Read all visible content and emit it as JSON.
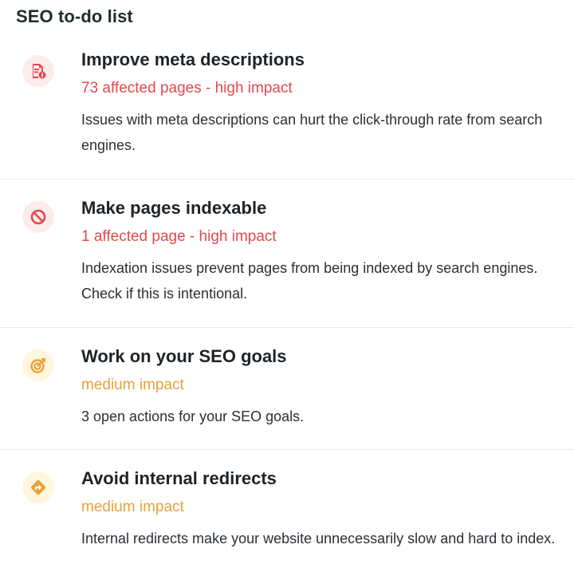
{
  "title": "SEO to-do list",
  "colors": {
    "high_impact": "#e5484d",
    "medium_impact": "#e8a13a",
    "red_badge_bg": "#fdecec",
    "yellow_badge_bg": "#fff6de"
  },
  "items": [
    {
      "icon": "document-info-icon",
      "title": "Improve meta descriptions",
      "impact": "73 affected pages - high impact",
      "description": "Issues with meta descriptions can hurt the click-through rate from search engines."
    },
    {
      "icon": "block-icon",
      "title": "Make pages indexable",
      "impact": "1 affected page - high impact",
      "description": "Indexation issues prevent pages from being indexed by search engines. Check if this is intentional."
    },
    {
      "icon": "target-icon",
      "title": "Work on your SEO goals",
      "impact": "medium impact",
      "description": "3 open actions for your SEO goals."
    },
    {
      "icon": "redirect-icon",
      "title": "Avoid internal redirects",
      "impact": "medium impact",
      "description": "Internal redirects make your website unnecessarily slow and hard to index."
    }
  ]
}
